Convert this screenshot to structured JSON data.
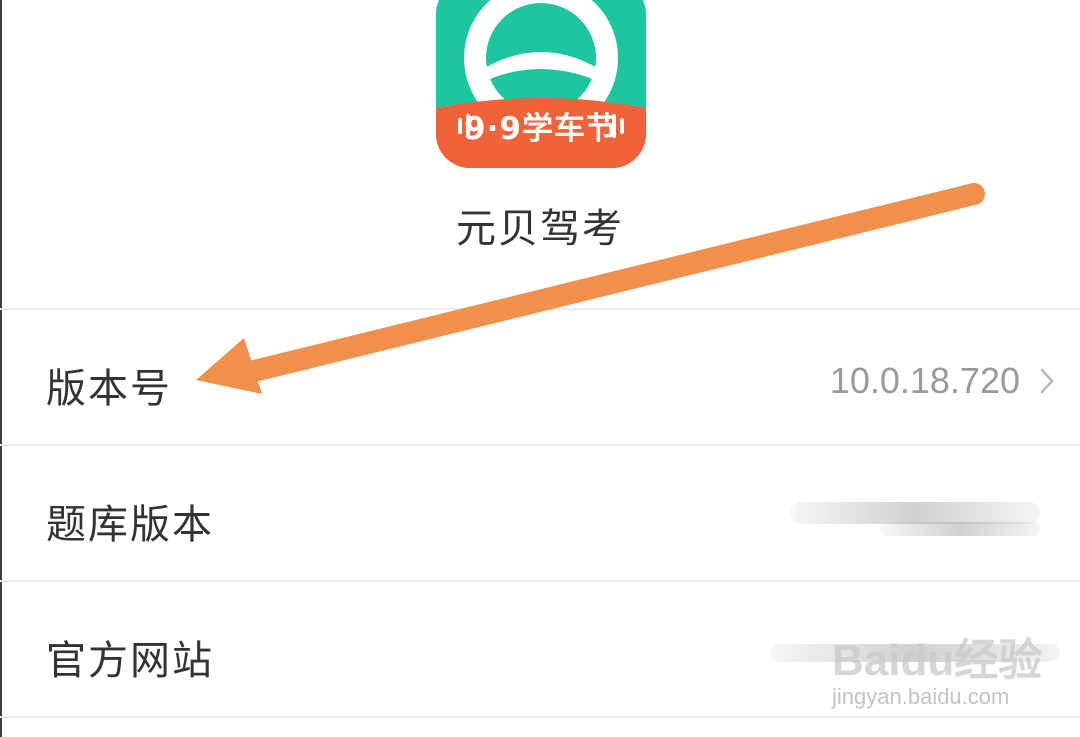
{
  "app": {
    "icon_name": "steering-wheel-icon",
    "promo_text": "9·9学车节",
    "name": "元贝驾考",
    "colors": {
      "icon_bg": "#1ec6a0",
      "banner": "#f0623a",
      "arrow": "#f0904a"
    }
  },
  "settings": {
    "items": [
      {
        "label": "版本号",
        "value": "10.0.18.720"
      },
      {
        "label": "题库版本",
        "value": ""
      },
      {
        "label": "官方网站",
        "value": ""
      }
    ]
  },
  "watermark": {
    "logo": "Baidu经验",
    "sub": "jingyan.baidu.com"
  }
}
